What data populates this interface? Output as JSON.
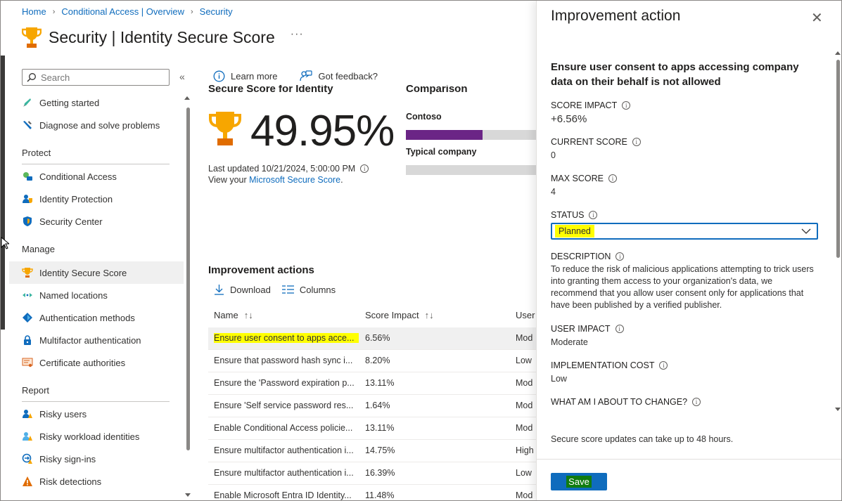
{
  "breadcrumb": [
    "Home",
    "Conditional Access | Overview",
    "Security"
  ],
  "page": {
    "title": "Security | Identity Secure Score",
    "more": "···"
  },
  "search": {
    "placeholder": "Search"
  },
  "sidebar": {
    "top_items": [
      {
        "label": "Getting started",
        "icon": "rocket-icon"
      },
      {
        "label": "Diagnose and solve problems",
        "icon": "wrench-icon"
      }
    ],
    "sections": [
      {
        "title": "Protect",
        "items": [
          {
            "label": "Conditional Access",
            "icon": "conditional-access-icon"
          },
          {
            "label": "Identity Protection",
            "icon": "identity-protection-icon"
          },
          {
            "label": "Security Center",
            "icon": "shield-icon"
          }
        ]
      },
      {
        "title": "Manage",
        "items": [
          {
            "label": "Identity Secure Score",
            "icon": "trophy-icon",
            "selected": true
          },
          {
            "label": "Named locations",
            "icon": "named-locations-icon"
          },
          {
            "label": "Authentication methods",
            "icon": "authentication-methods-icon"
          },
          {
            "label": "Multifactor authentication",
            "icon": "lock-icon"
          },
          {
            "label": "Certificate authorities",
            "icon": "certificate-icon"
          }
        ]
      },
      {
        "title": "Report",
        "items": [
          {
            "label": "Risky users",
            "icon": "risky-users-icon"
          },
          {
            "label": "Risky workload identities",
            "icon": "risky-workload-icon"
          },
          {
            "label": "Risky sign-ins",
            "icon": "risky-signins-icon"
          },
          {
            "label": "Risk detections",
            "icon": "warning-icon"
          }
        ]
      }
    ]
  },
  "toolbar": {
    "learn_more": "Learn more",
    "feedback": "Got feedback?"
  },
  "score": {
    "heading": "Secure Score for Identity",
    "value": "49.95%",
    "last_updated": "Last updated 10/21/2024, 5:00:00 PM",
    "view_prefix": "View your ",
    "view_link": "Microsoft Secure Score",
    "view_suffix": "."
  },
  "comparison": {
    "heading": "Comparison",
    "items": [
      {
        "label": "Contoso",
        "fraction": 0.5747,
        "color": "#6b2586"
      },
      {
        "label": "Typical company",
        "fraction": 0,
        "color": "#6b2586"
      }
    ]
  },
  "improvement_actions": {
    "heading": "Improvement actions",
    "download": "Download",
    "columns": "Columns",
    "col_name": "Name",
    "col_impact": "Score Impact",
    "col_user": "User",
    "rows": [
      {
        "name": "Ensure user consent to apps acce...",
        "impact": "6.56%",
        "user": "Mod",
        "selected": true
      },
      {
        "name": "Ensure that password hash sync i...",
        "impact": "8.20%",
        "user": "Low"
      },
      {
        "name": "Ensure the 'Password expiration p...",
        "impact": "13.11%",
        "user": "Mod"
      },
      {
        "name": "Ensure 'Self service password res...",
        "impact": "1.64%",
        "user": "Mod"
      },
      {
        "name": "Enable Conditional Access policie...",
        "impact": "13.11%",
        "user": "Mod"
      },
      {
        "name": "Ensure multifactor authentication i...",
        "impact": "14.75%",
        "user": "High"
      },
      {
        "name": "Ensure multifactor authentication i...",
        "impact": "16.39%",
        "user": "Low"
      },
      {
        "name": "Enable Microsoft Entra ID Identity...",
        "impact": "11.48%",
        "user": "Mod"
      }
    ]
  },
  "panel": {
    "title": "Improvement action",
    "close": "✕",
    "action_title": "Ensure user consent to apps accessing company data on their behalf is not allowed",
    "score_impact_label": "SCORE IMPACT",
    "score_impact_value": "+6.56%",
    "current_score_label": "CURRENT SCORE",
    "current_score_value": "0",
    "max_score_label": "MAX SCORE",
    "max_score_value": "4",
    "status_label": "STATUS",
    "status_value": "Planned",
    "description_label": "DESCRIPTION",
    "description": "To reduce the risk of malicious applications attempting to trick users into granting them access to your organization's data, we recommend that you allow user consent only for applications that have been published by a verified publisher.",
    "user_impact_label": "USER IMPACT",
    "user_impact_value": "Moderate",
    "impl_cost_label": "IMPLEMENTATION COST",
    "impl_cost_value": "Low",
    "change_label": "WHAT AM I ABOUT TO CHANGE?",
    "note": "Secure score updates can take up to 48 hours.",
    "save": "Save"
  },
  "colors": {
    "accent": "#0f6cbd",
    "highlight": "#ffff00",
    "save_text_bg": "#107c10",
    "comparison_fill": "#6b2586"
  }
}
